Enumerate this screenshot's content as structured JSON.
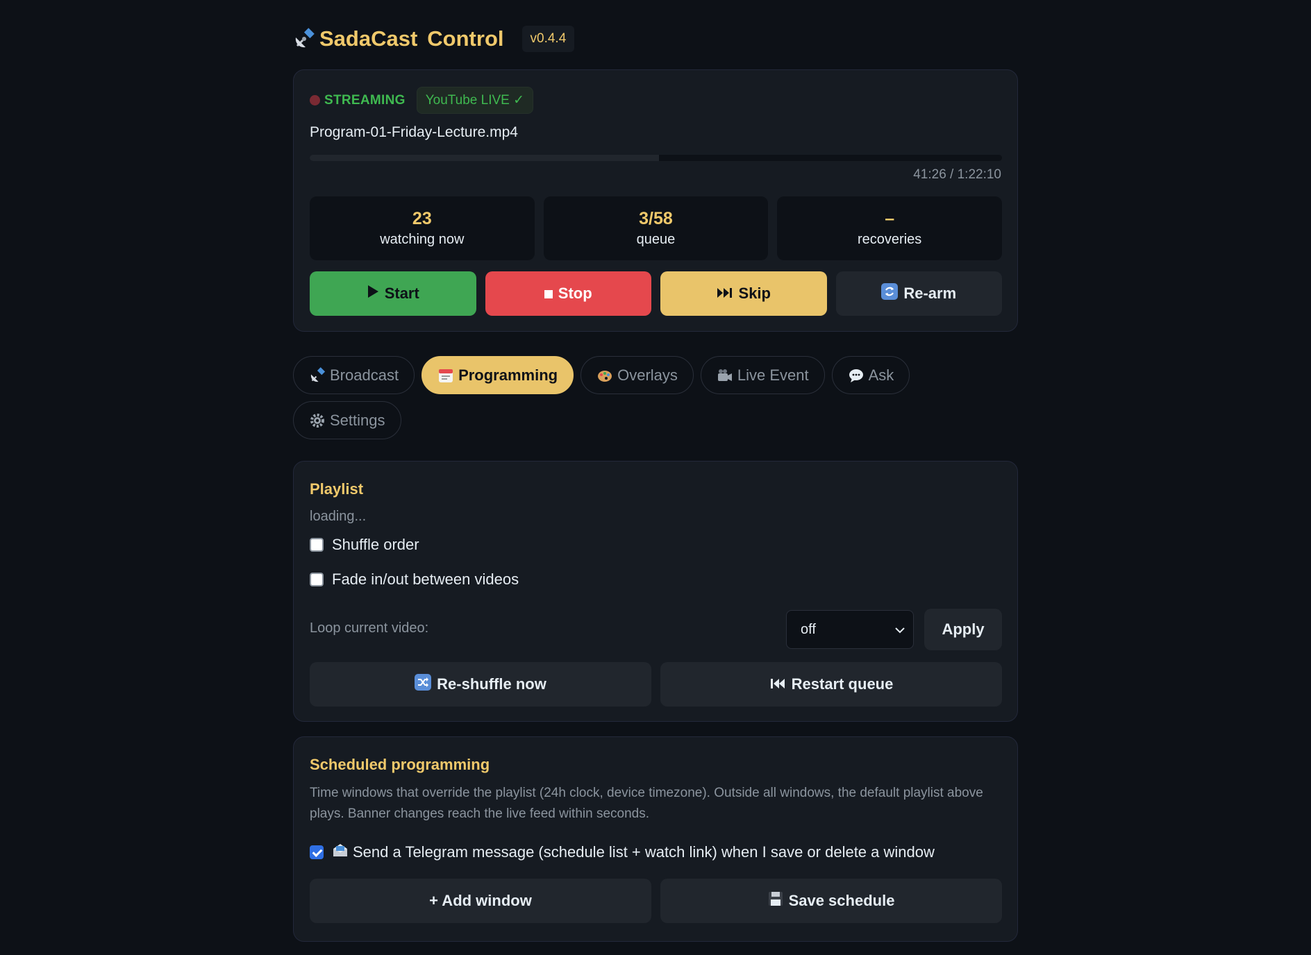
{
  "header": {
    "title_a": "SadaCast",
    "title_b": "Control",
    "version": "v0.4.4",
    "icon": "satellite-icon"
  },
  "status": {
    "state": "STREAMING",
    "youtube_badge": "YouTube LIVE ✓",
    "filename": "Program-01-Friday-Lecture.mp4",
    "progress_fraction": 0.505,
    "timecode": "41:26 / 1:22:10",
    "stats": [
      {
        "value": "23",
        "label": "watching now"
      },
      {
        "value": "3/58",
        "label": "queue"
      },
      {
        "value": "–",
        "label": "recoveries"
      }
    ],
    "buttons": {
      "start": "Start",
      "stop": "Stop",
      "skip": "Skip",
      "rearm": "Re-arm"
    }
  },
  "tabs": [
    {
      "label": "Broadcast",
      "icon": "satellite-icon"
    },
    {
      "label": "Programming",
      "icon": "calendar-icon"
    },
    {
      "label": "Overlays",
      "icon": "palette-icon"
    },
    {
      "label": "Live Event",
      "icon": "camera-icon"
    },
    {
      "label": "Ask",
      "icon": "speech-bubble-icon"
    },
    {
      "label": "Settings",
      "icon": "gear-icon"
    }
  ],
  "playlist": {
    "title": "Playlist",
    "loading": "loading...",
    "shuffle_label": "Shuffle order",
    "fade_label": "Fade in/out between videos",
    "loop_label": "Loop current video:",
    "loop_value": "off",
    "apply": "Apply",
    "reshuffle": "Re-shuffle now",
    "restart": "Restart queue"
  },
  "schedule": {
    "title": "Scheduled programming",
    "description": "Time windows that override the playlist (24h clock, device timezone). Outside all windows, the default playlist above plays. Banner changes reach the live feed within seconds.",
    "telegram_label": "Send a Telegram message (schedule list + watch link) when I save or delete a window",
    "add_window": "+ Add window",
    "save_schedule": "Save schedule"
  },
  "colors": {
    "background": "#0d1117",
    "card": "#161b22",
    "accent": "#f0c96b",
    "green": "#3fa653",
    "red": "#e5484d",
    "yellow": "#e9c46a"
  }
}
